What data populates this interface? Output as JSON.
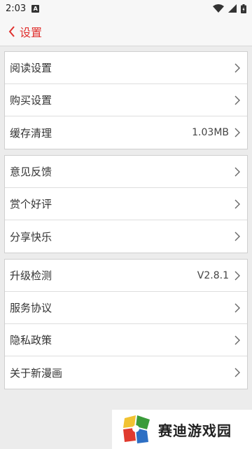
{
  "status_bar": {
    "time": "2:03",
    "notification_icon": "A"
  },
  "header": {
    "title": "设置"
  },
  "groups": [
    {
      "items": [
        {
          "label": "阅读设置",
          "value": ""
        },
        {
          "label": "购买设置",
          "value": ""
        },
        {
          "label": "缓存清理",
          "value": "1.03MB"
        }
      ]
    },
    {
      "items": [
        {
          "label": "意见反馈",
          "value": ""
        },
        {
          "label": "赏个好评",
          "value": ""
        },
        {
          "label": "分享快乐",
          "value": ""
        }
      ]
    },
    {
      "items": [
        {
          "label": "升级检测",
          "value": "V2.8.1"
        },
        {
          "label": "服务协议",
          "value": ""
        },
        {
          "label": "隐私政策",
          "value": ""
        },
        {
          "label": "关于新漫画",
          "value": ""
        }
      ]
    }
  ],
  "watermark": {
    "text": "赛迪游戏园"
  },
  "colors": {
    "accent": "#e0302e",
    "background": "#ececec",
    "card": "#ffffff"
  }
}
